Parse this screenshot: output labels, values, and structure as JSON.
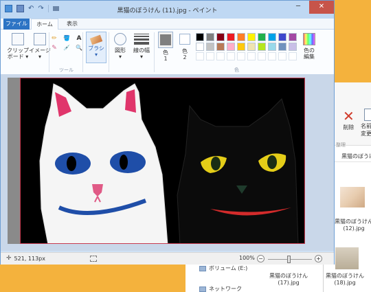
{
  "titlebar": {
    "title": "黒猫のぼうけん (11).jpg - ペイント",
    "undo_glyph": "↶",
    "redo_glyph": "↷",
    "minimize_glyph": "─",
    "close_glyph": "✕"
  },
  "tabs": [
    {
      "label": "ファイル"
    },
    {
      "label": "ホーム"
    },
    {
      "label": "表示"
    }
  ],
  "ribbon": {
    "clipboard_label": "クリップ\nボード ▾",
    "image_label": "イメージ\n▾",
    "tools_group": "ツール",
    "brush_label": "ブラシ\n▾",
    "shapes_label": "図形\n▾",
    "line_width_label": "線の幅\n▾",
    "color1_label": "色\n1",
    "color2_label": "色\n2",
    "color_group": "色",
    "edit_colors_label": "色の\n編集",
    "tool_icons": [
      "✏",
      "🪣",
      "A",
      "✎",
      "💉",
      "🔍"
    ],
    "palette": [
      "#000000",
      "#7f7f7f",
      "#880015",
      "#ed1c24",
      "#ff7f27",
      "#fff200",
      "#22b14c",
      "#00a2e8",
      "#3f48cc",
      "#a349a4",
      "#ffffff",
      "#c3c3c3",
      "#b97a57",
      "#ffaec9",
      "#ffc90e",
      "#efe4b0",
      "#b5e61d",
      "#99d9ea",
      "#7092be",
      "#c8bfe7",
      "#ffffff",
      "#ffffff",
      "#ffffff",
      "#ffffff",
      "#ffffff",
      "#ffffff",
      "#ffffff",
      "#ffffff",
      "#ffffff",
      "#ffffff"
    ]
  },
  "statusbar": {
    "position": "521, 113px",
    "cursor_glyph": "✛",
    "zoom": "100%",
    "zoom_minus": "−",
    "zoom_plus": "+"
  },
  "explorer": {
    "delete_label": "削除",
    "delete_glyph": "✕",
    "rename_label": "名前の\n変更",
    "group_label": "整理",
    "path": "黒猫のぼうけん",
    "thumb_label_top": "黒猫のぼうけん\n(12).jpg",
    "nav_volume": "ボリューム (E:)",
    "nav_network": "ネットワーク",
    "thumb_label_17": "黒猫のぼうけん\n(17).jpg",
    "thumb_label_18": "黒猫のぼうけん\n(18).jpg"
  }
}
